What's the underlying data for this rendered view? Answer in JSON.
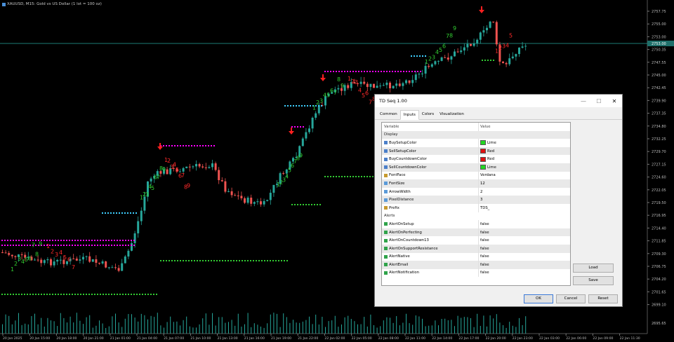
{
  "chart": {
    "symbol_title": "XAUUSD, M15:  Gold vs US Dollar  (1 lot = 100 oz)",
    "colors": {
      "bull": "#26a69a",
      "bear": "#ef5350",
      "buy_setup": "#32cd32",
      "sell_setup": "#ff2a2a",
      "support": "#32cd32",
      "resistance": "#ff00ff",
      "tdst": "#3fd0ff",
      "volume": "#26a69a",
      "bid_line": "#26a69a"
    },
    "price_levels": [
      "2757.75",
      "2755.00",
      "2753.00",
      "2750.35",
      "2747.55",
      "2745.00",
      "2742.45",
      "2739.90",
      "2737.35",
      "2734.80",
      "2732.25",
      "2729.70",
      "2727.15",
      "2724.60",
      "2722.05",
      "2719.50",
      "2716.95",
      "2714.40",
      "2711.85",
      "2709.30",
      "2706.75",
      "2704.20",
      "2701.65",
      "2699.10"
    ],
    "volume_label": "2695.65",
    "current_price": "2753.00",
    "time_labels": [
      "20 Jan 2025",
      "20 Jan 15:00",
      "20 Jan 18:00",
      "20 Jan 21:00",
      "21 Jan 01:00",
      "21 Jan 04:00",
      "21 Jan 07:00",
      "21 Jan 10:00",
      "21 Jan 13:00",
      "21 Jan 16:00",
      "21 Jan 19:00",
      "21 Jan 22:00",
      "22 Jan 02:00",
      "22 Jan 05:00",
      "22 Jan 08:00",
      "22 Jan 11:00",
      "22 Jan 14:00",
      "22 Jan 17:00",
      "22 Jan 20:00",
      "22 Jan 23:00",
      "22 Jan 03:00",
      "22 Jan 06:00",
      "22 Jan 09:00",
      "22 Jan 11:30"
    ]
  },
  "dialog": {
    "title": "TD Seq 1.00",
    "minimize_icon": "—",
    "maximize_icon": "☐",
    "close_icon": "✕",
    "tabs": [
      "Common",
      "Inputs",
      "Colors",
      "Visualization"
    ],
    "active_tab": "Inputs",
    "columns": {
      "variable": "Variable",
      "value": "Value"
    },
    "sections": {
      "display": "Display",
      "alerts": "Alerts"
    },
    "display_params": [
      {
        "name": "BuySetupColor",
        "value": "Lime",
        "icon": "color-param-icon",
        "color": "#22d622"
      },
      {
        "name": "SellSetupColor",
        "value": "Red",
        "icon": "color-param-icon",
        "color": "#e01010"
      },
      {
        "name": "BuyCountdownColor",
        "value": "Red",
        "icon": "color-param-icon",
        "color": "#e01010"
      },
      {
        "name": "SellCountdownColor",
        "value": "Lime",
        "icon": "color-param-icon",
        "color": "#22d622"
      },
      {
        "name": "FontFace",
        "value": "Verdana",
        "icon": "font-param-icon"
      },
      {
        "name": "FontSize",
        "value": "12",
        "icon": "number-param-icon"
      },
      {
        "name": "ArrowWidth",
        "value": "2",
        "icon": "number-param-icon"
      },
      {
        "name": "PixelDistance",
        "value": "3",
        "icon": "number-param-icon"
      },
      {
        "name": "Prefix",
        "value": "TDS_",
        "icon": "text-param-icon"
      }
    ],
    "alert_params": [
      {
        "name": "AlertOnSetup",
        "value": "false",
        "icon": "flag-param-icon"
      },
      {
        "name": "AlertOnPerfecting",
        "value": "false",
        "icon": "flag-param-icon"
      },
      {
        "name": "AlertOnCountdown13",
        "value": "false",
        "icon": "flag-param-icon"
      },
      {
        "name": "AlertOnSupportResistance",
        "value": "false",
        "icon": "flag-param-icon"
      },
      {
        "name": "AlertNative",
        "value": "false",
        "icon": "flag-param-icon"
      },
      {
        "name": "AlertEmail",
        "value": "false",
        "icon": "flag-param-icon"
      },
      {
        "name": "AlertNotification",
        "value": "false",
        "icon": "flag-param-icon"
      }
    ],
    "buttons": {
      "load": "Load",
      "save": "Save",
      "ok": "OK",
      "cancel": "Cancel",
      "reset": "Reset"
    }
  }
}
